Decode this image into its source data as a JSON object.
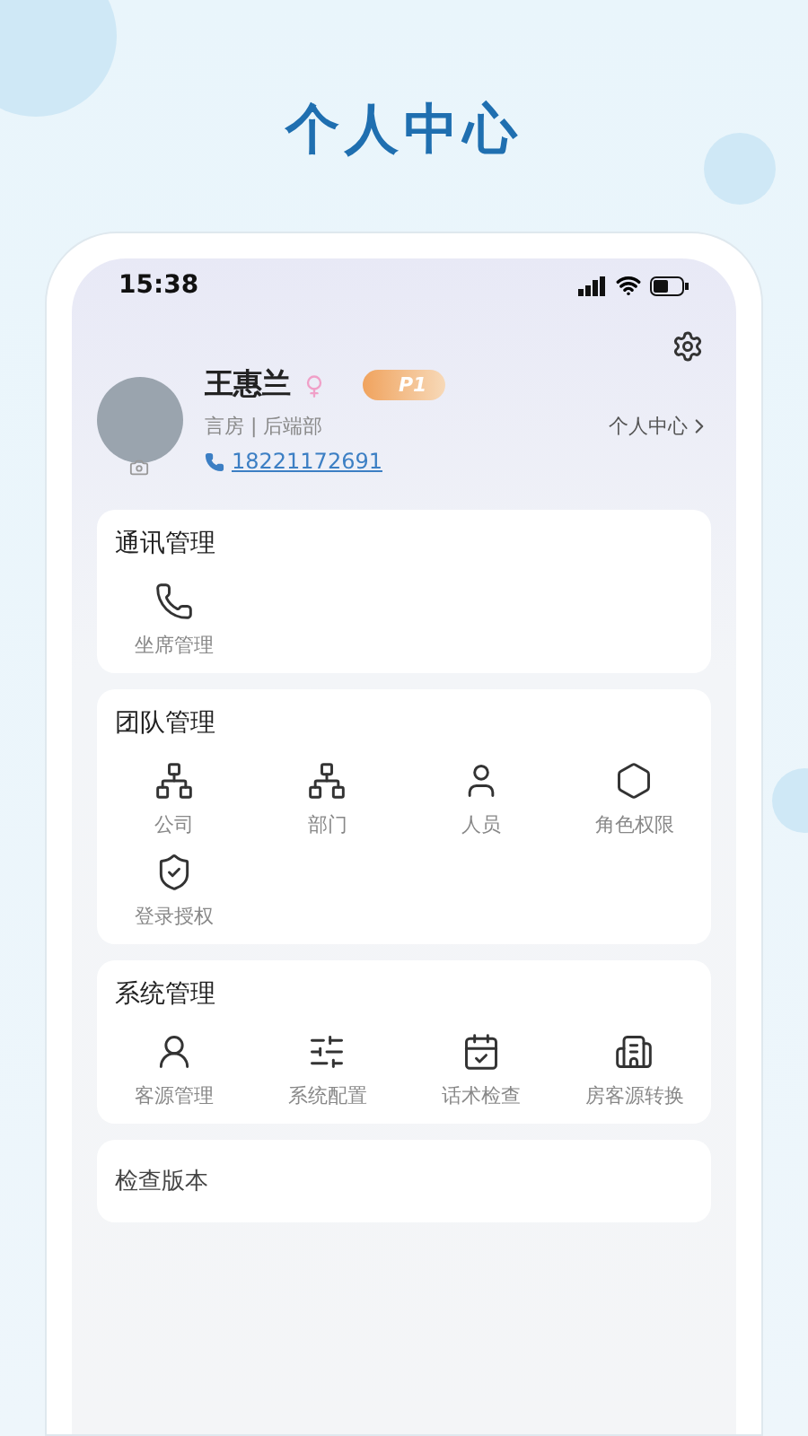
{
  "page_title": "个人中心",
  "status_bar": {
    "time": "15:38"
  },
  "profile": {
    "name": "王惠兰",
    "level_badge": "P1",
    "department": "言房 | 后端部",
    "phone": "18221172691",
    "link": "个人中心"
  },
  "sections": [
    {
      "title": "通讯管理",
      "items": [
        "坐席管理"
      ]
    },
    {
      "title": "团队管理",
      "items": [
        "公司",
        "部门",
        "人员",
        "角色权限",
        "登录授权"
      ]
    },
    {
      "title": "系统管理",
      "items": [
        "客源管理",
        "系统配置",
        "话术检查",
        "房客源转换"
      ]
    }
  ],
  "list_rows": [
    "检查版本"
  ]
}
